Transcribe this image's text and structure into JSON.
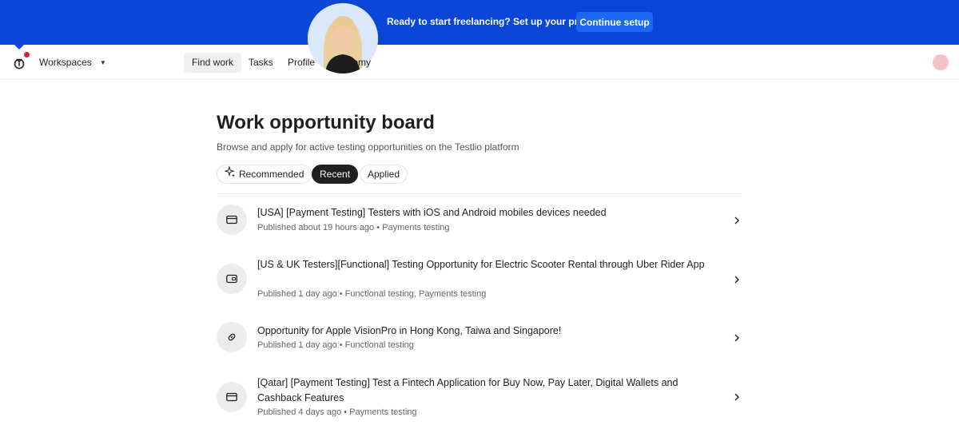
{
  "banner": {
    "text": "Ready to start freelancing? Set up your profile",
    "button": "Continue setup"
  },
  "nav": {
    "workspaces": "Workspaces",
    "items": [
      {
        "label": "Find work",
        "active": true
      },
      {
        "label": "Tasks",
        "active": false
      },
      {
        "label": "Profile",
        "active": false
      },
      {
        "label": "Academy",
        "active": false
      }
    ]
  },
  "main": {
    "title": "Work opportunity board",
    "subtitle": "Browse and apply for active testing opportunities on the Testlio platform",
    "tabs": [
      {
        "label": "Recommended",
        "icon": "sparkle-icon",
        "active": false
      },
      {
        "label": "Recent",
        "active": true
      },
      {
        "label": "Applied",
        "active": false
      }
    ],
    "opportunities": [
      {
        "icon": "credit-card-icon",
        "title": "[USA] [Payment Testing] Testers with iOS and Android mobiles devices needed",
        "meta": "Published about 19 hours ago • Payments testing"
      },
      {
        "icon": "wallet-icon",
        "title": "[US & UK Testers][Functional] Testing Opportunity for Electric Scooter Rental through Uber Rider App",
        "meta": "Published 1 day ago • Functional testing, Payments testing"
      },
      {
        "icon": "link-icon",
        "title": "Opportunity for Apple VisionPro in Hong Kong, Taiwa and Singapore!",
        "meta": "Published 1 day ago • Functional testing"
      },
      {
        "icon": "credit-card-icon",
        "title": "[Qatar] [Payment Testing] Test a Fintech Application for Buy Now, Pay Later, Digital Wallets and Cashback Features",
        "meta": "Published 4 days ago • Payments testing"
      }
    ]
  },
  "colors": {
    "banner": "#0a47d6",
    "button": "#1c68f5",
    "notification_dot": "#e0222b",
    "active_tab": "#1f1f1f"
  }
}
